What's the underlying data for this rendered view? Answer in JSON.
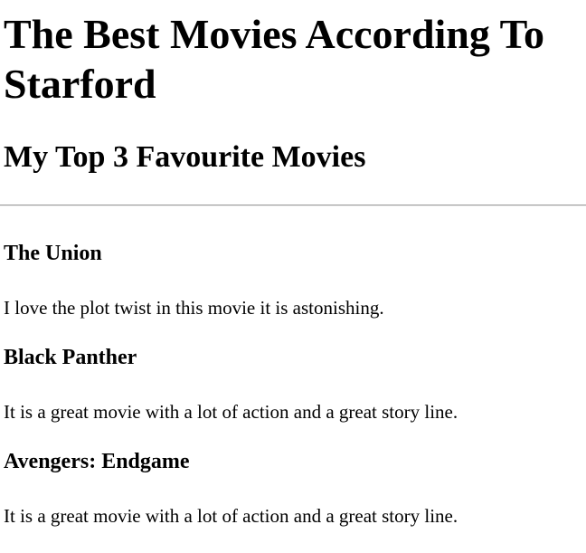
{
  "page_title": "The Best Movies According To Starford",
  "subtitle": "My Top 3 Favourite Movies",
  "movies": [
    {
      "title": "The Union",
      "description": "I love the plot twist in this movie it is astonishing."
    },
    {
      "title": "Black Panther",
      "description": "It is a great movie with a lot of action and a great story line."
    },
    {
      "title": "Avengers: Endgame",
      "description": "It is a great movie with a lot of action and a great story line."
    }
  ]
}
